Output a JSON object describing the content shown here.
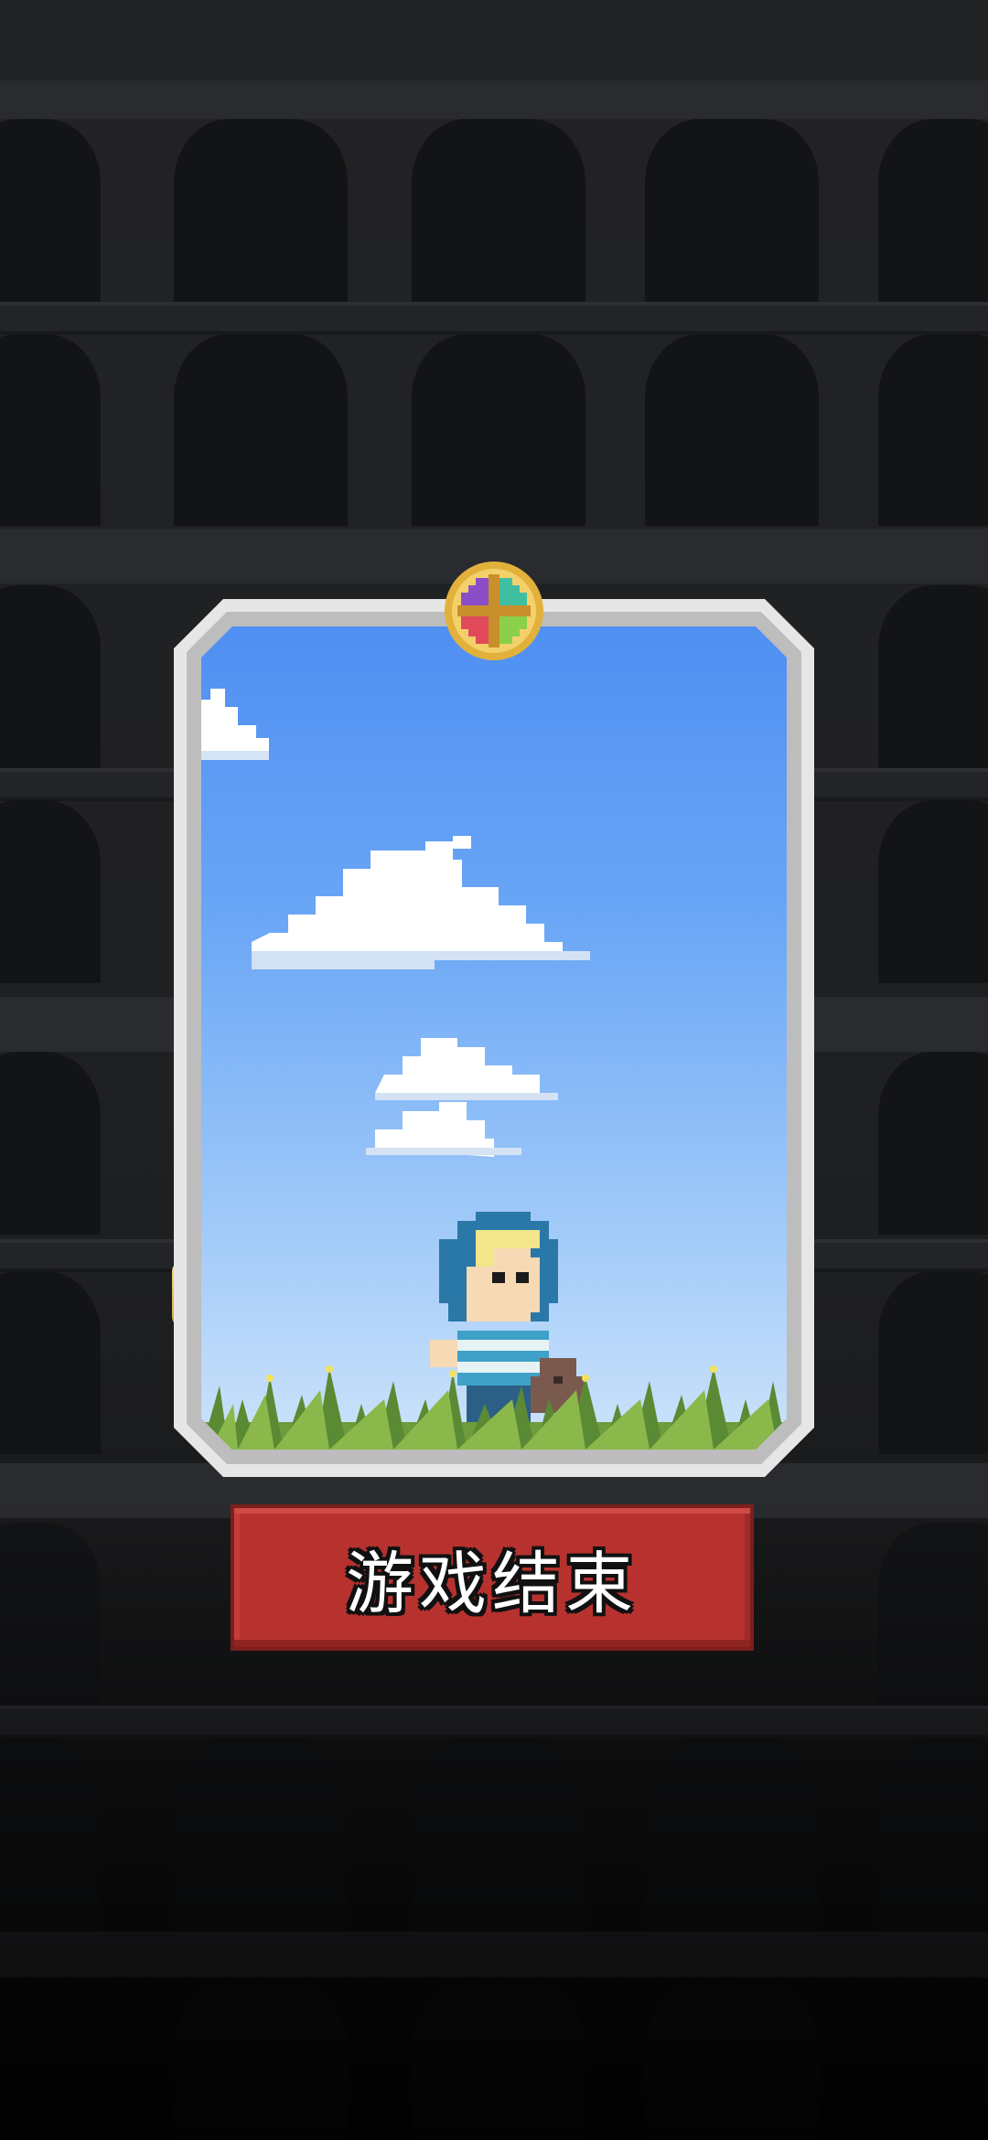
{
  "screen": {
    "name": "game-over-screen"
  },
  "card": {
    "scene": "sky-with-clouds-and-grass",
    "character": "hooded-kid-with-bear"
  },
  "button": {
    "label": "游戏结束"
  },
  "colors": {
    "button_red": "#b7322f",
    "sky_top": "#4f8ff2",
    "sky_bottom": "#cde3fb",
    "card_frame": "#e6e6e6",
    "background": "#1a1b1d",
    "emblem_gold": "#e2b13c"
  },
  "icons": {
    "emblem": "clover-emblem-icon"
  }
}
